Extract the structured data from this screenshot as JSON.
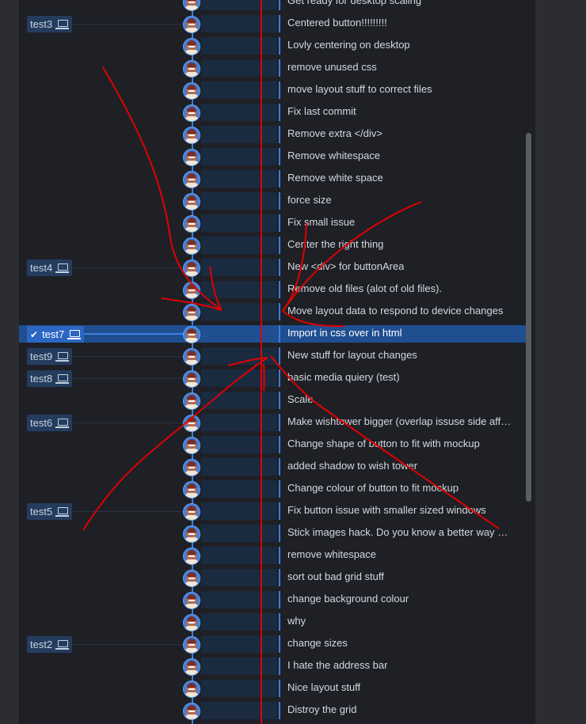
{
  "commits": [
    {
      "message": "Get ready for desktop scaling",
      "tag": null
    },
    {
      "message": "Centered button!!!!!!!!!",
      "tag": "test3"
    },
    {
      "message": "Lovly centering on desktop",
      "tag": null
    },
    {
      "message": "remove unused css",
      "tag": null
    },
    {
      "message": "move layout stuff to correct files",
      "tag": null
    },
    {
      "message": "Fix last commit",
      "tag": null
    },
    {
      "message": "Remove extra </div>",
      "tag": null
    },
    {
      "message": "Remove whitespace",
      "tag": null
    },
    {
      "message": "Remove white space",
      "tag": null
    },
    {
      "message": "force size",
      "tag": null
    },
    {
      "message": "Fix small issue",
      "tag": null
    },
    {
      "message": "Center the right thing",
      "tag": null
    },
    {
      "message": "New <div> for buttonArea",
      "tag": "test4"
    },
    {
      "message": "Remove old files (alot of old files).",
      "tag": null
    },
    {
      "message": "Move layout data to respond to device changes",
      "tag": null
    },
    {
      "message": "Import in css over in html",
      "tag": "test7",
      "selected": true
    },
    {
      "message": "New stuff for layout changes",
      "tag": "test9"
    },
    {
      "message": "basic media quiery (test)",
      "tag": "test8"
    },
    {
      "message": "Scale",
      "tag": null
    },
    {
      "message": "Make wishtower bigger (overlap issuse side affect)",
      "tag": "test6"
    },
    {
      "message": "Change shape of button to fit with mockup",
      "tag": null
    },
    {
      "message": "added shadow to wish tower",
      "tag": null
    },
    {
      "message": "Change colour of button to fit mockup",
      "tag": null
    },
    {
      "message": "Fix button issue with smaller sized windows",
      "tag": "test5"
    },
    {
      "message": "Stick images hack. Do you know a better way of ...",
      "tag": null
    },
    {
      "message": "remove whitespace",
      "tag": null
    },
    {
      "message": "sort out bad grid stuff",
      "tag": null
    },
    {
      "message": "change background colour",
      "tag": null
    },
    {
      "message": "why",
      "tag": null
    },
    {
      "message": "change sizes",
      "tag": "test2"
    },
    {
      "message": "I hate the address bar",
      "tag": null
    },
    {
      "message": "Nice layout stuff",
      "tag": null
    },
    {
      "message": "Distroy the grid",
      "tag": null
    }
  ],
  "icons": {
    "tag": "laptop-icon",
    "selected": "checkmark-icon",
    "avatar": "author-avatar-icon"
  },
  "colors": {
    "accent": "#3b7fe0",
    "selected_row": "#1f4e91",
    "tag_bg": "#243c5e",
    "annotation": "#e00000"
  }
}
